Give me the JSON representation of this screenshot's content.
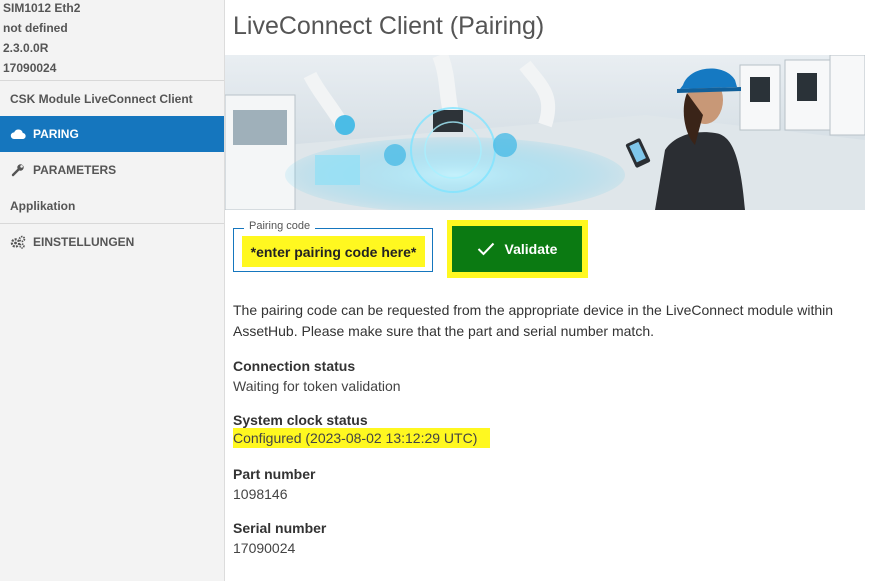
{
  "device": {
    "name": "SIM1012 Eth2",
    "location": "not defined",
    "version": "2.3.0.0R",
    "serial": "17090024"
  },
  "sidebar": {
    "module_heading": "CSK Module LiveConnect Client",
    "items": [
      {
        "label": "PARING",
        "icon": "cloud-icon",
        "active": true
      },
      {
        "label": "PARAMETERS",
        "icon": "wrench-icon",
        "active": false
      }
    ],
    "app_heading": "Applikation",
    "settings": {
      "label": "EINSTELLUNGEN",
      "icon": "gears-icon"
    }
  },
  "main": {
    "title": "LiveConnect Client (Pairing)",
    "pairing": {
      "legend": "Pairing code",
      "placeholder": "*enter pairing code here*",
      "value": ""
    },
    "validate_label": "Validate",
    "description": "The pairing code can be requested from the appropriate device in the LiveConnect module within AssetHub. Please make sure that the part and serial number match.",
    "connection_status": {
      "label": "Connection status",
      "value": "Waiting for token validation"
    },
    "clock_status": {
      "label": "System clock status",
      "value": "Configured (2023-08-02 13:12:29 UTC)"
    },
    "part_number": {
      "label": "Part number",
      "value": "1098146"
    },
    "serial_number": {
      "label": "Serial number",
      "value": "17090024"
    }
  },
  "colors": {
    "accent": "#1576be",
    "validate": "#0b7a12",
    "highlight": "#fff820"
  }
}
